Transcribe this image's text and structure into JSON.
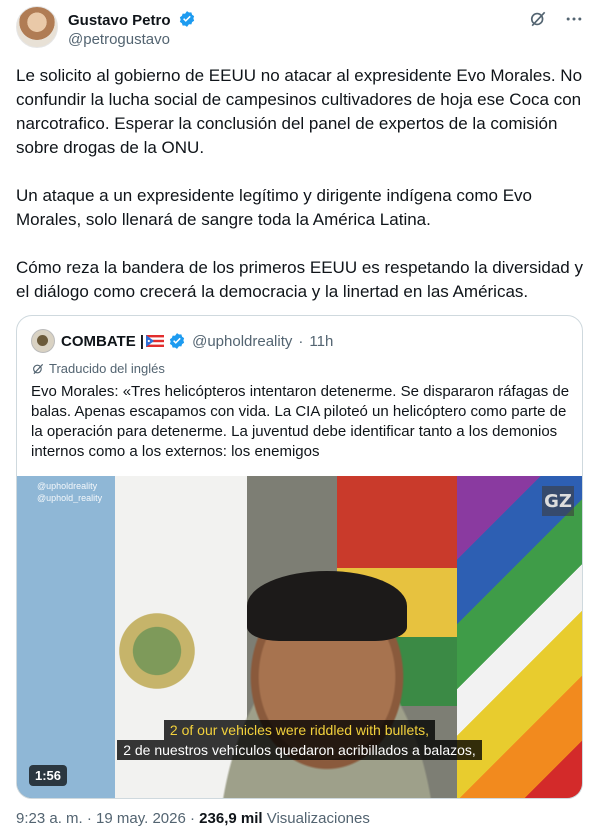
{
  "author": {
    "name": "Gustavo Petro",
    "handle": "@petrogustavo"
  },
  "tweet": {
    "paragraphs": [
      "Le solicito al gobierno de EEUU no atacar al expresidente Evo Morales. No confundir la lucha social de campesinos cultivadores de hoja ese Coca con narcotrafico. Esperar la conclusión del panel de expertos de la comisión sobre drogas de la ONU.",
      "Un ataque a un expresidente legítimo y dirigente indígena como Evo Morales, solo llenará de sangre toda la América Latina.",
      "Cómo reza la bandera de los primeros EEUU es respetando la diversidad y el diálogo como crecerá la democracia y la linertad en las Américas."
    ]
  },
  "quote": {
    "name": "COMBATE |",
    "handle": "@upholdreality",
    "separator": "·",
    "time": "11h",
    "translated_label": "Traducido del inglés",
    "text": "Evo Morales: «Tres helicópteros intentaron detenerme. Se dispararon ráfagas de balas. Apenas escapamos con vida. La CIA piloteó un helicóptero como parte de la operación para detenerme. La juventud debe identificar tanto a los demonios internos como a los externos: los enemigos",
    "media": {
      "watermark_line1": "@upholdreality",
      "watermark_line2": "@uphold_reality",
      "corner_logo": "GZ",
      "subtitle_en": "2 of our vehicles were riddled with bullets,",
      "subtitle_es": "2 de nuestros vehículos quedaron acribillados a balazos,",
      "duration": "1:56"
    }
  },
  "meta": {
    "time": "9:23 a. m.",
    "dot": "·",
    "date": "19 may. 2026",
    "views_count": "236,9 mil",
    "views_label": "Visualizaciones"
  },
  "colors": {
    "verified_blue": "#1d9bf0",
    "secondary_text": "#536471",
    "subtitle_yellow": "#f2d13c"
  },
  "icons": [
    "verified-icon",
    "grok-icon",
    "more-icon",
    "translate-icon"
  ]
}
